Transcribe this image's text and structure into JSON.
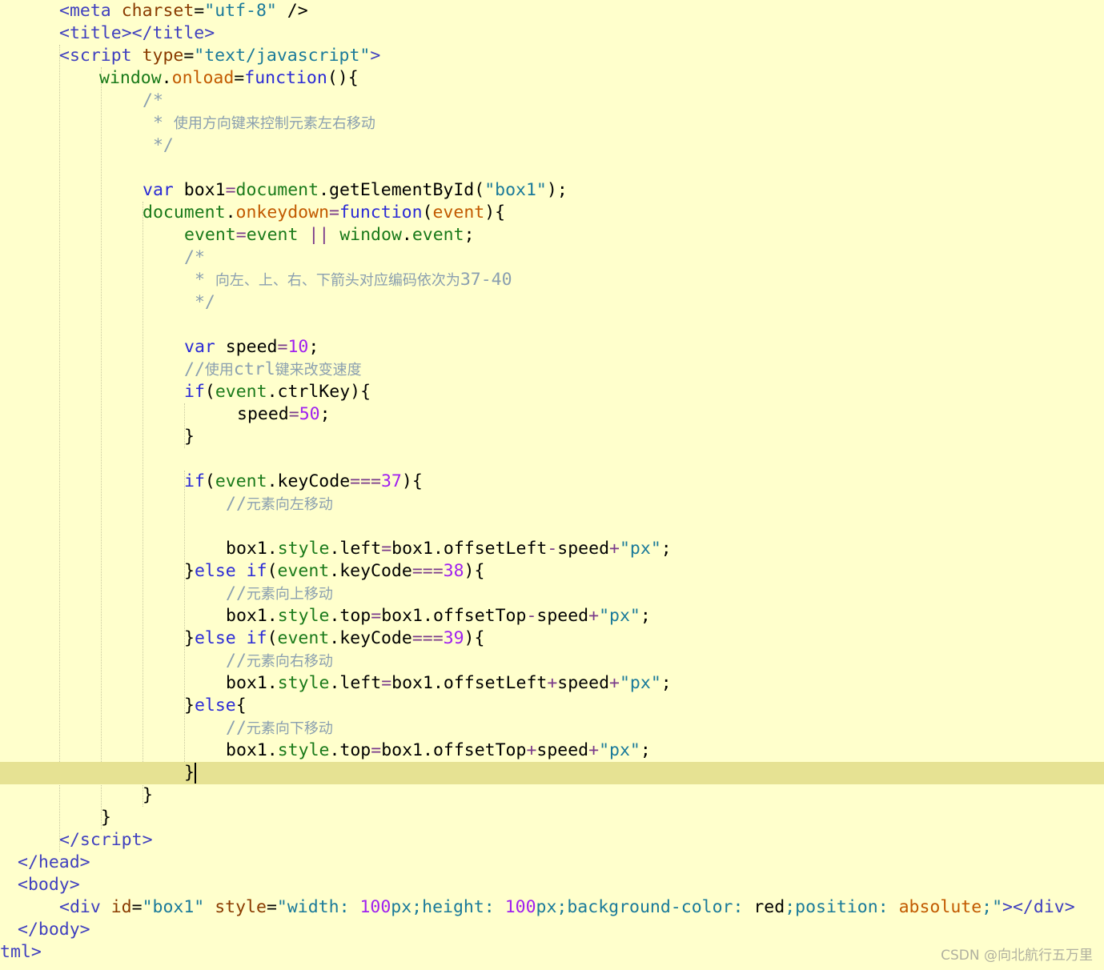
{
  "editor": {
    "lines": [
      {
        "tokens": [
          [
            "tag",
            "<"
          ],
          [
            "tag",
            "meta "
          ],
          [
            "attr",
            "charset"
          ],
          [
            "plain",
            "="
          ],
          [
            "str",
            "\"utf-8\""
          ],
          [
            "plain",
            " />"
          ]
        ]
      },
      {
        "tokens": [
          [
            "tag",
            "<"
          ],
          [
            "tag",
            "title"
          ],
          [
            "tag",
            ">"
          ],
          [
            "tag",
            "</"
          ],
          [
            "tag",
            "title"
          ],
          [
            "tag",
            ">"
          ]
        ]
      },
      {
        "tokens": [
          [
            "tag",
            "<"
          ],
          [
            "tag",
            "script "
          ],
          [
            "attr",
            "type"
          ],
          [
            "plain",
            "="
          ],
          [
            "str",
            "\"text/javascript\""
          ],
          [
            "tag",
            ">"
          ]
        ]
      },
      {
        "tokens": [
          [
            "js",
            "window"
          ],
          [
            "plain",
            "."
          ],
          [
            "prop",
            "onload"
          ],
          [
            "plain",
            "="
          ],
          [
            "kw",
            "function"
          ],
          [
            "plain",
            "(){"
          ]
        ]
      },
      {
        "tokens": [
          [
            "commentmono",
            "/*"
          ]
        ]
      },
      {
        "tokens": [
          [
            "commentmono",
            " * "
          ],
          [
            "comment",
            "使用方向键来控制元素左右移动"
          ]
        ]
      },
      {
        "tokens": [
          [
            "commentmono",
            " */"
          ]
        ]
      },
      {
        "tokens": []
      },
      {
        "tokens": [
          [
            "kw",
            "var "
          ],
          [
            "plain",
            "box1"
          ],
          [
            "op",
            "="
          ],
          [
            "js",
            "document"
          ],
          [
            "plain",
            "."
          ],
          [
            "plain",
            "getElementById"
          ],
          [
            "plain",
            "("
          ],
          [
            "str",
            "\"box1\""
          ],
          [
            "plain",
            ");"
          ]
        ]
      },
      {
        "tokens": [
          [
            "js",
            "document"
          ],
          [
            "plain",
            "."
          ],
          [
            "prop",
            "onkeydown"
          ],
          [
            "op",
            "="
          ],
          [
            "kw",
            "function"
          ],
          [
            "plain",
            "("
          ],
          [
            "prop",
            "event"
          ],
          [
            "plain",
            "){"
          ]
        ]
      },
      {
        "tokens": [
          [
            "js",
            "event"
          ],
          [
            "op",
            "="
          ],
          [
            "js",
            "event"
          ],
          [
            "plain",
            " "
          ],
          [
            "op",
            "||"
          ],
          [
            "plain",
            " "
          ],
          [
            "js",
            "window"
          ],
          [
            "plain",
            "."
          ],
          [
            "js",
            "event"
          ],
          [
            "plain",
            ";"
          ]
        ]
      },
      {
        "tokens": [
          [
            "commentmono",
            "/*"
          ]
        ]
      },
      {
        "tokens": [
          [
            "commentmono",
            " * "
          ],
          [
            "comment",
            "向左、上、右、下箭头对应编码依次为"
          ],
          [
            "commentmono",
            "37-40"
          ]
        ]
      },
      {
        "tokens": [
          [
            "commentmono",
            " */"
          ]
        ]
      },
      {
        "tokens": []
      },
      {
        "tokens": [
          [
            "kw",
            "var "
          ],
          [
            "plain",
            "speed"
          ],
          [
            "op",
            "="
          ],
          [
            "num",
            "10"
          ],
          [
            "plain",
            ";"
          ]
        ]
      },
      {
        "tokens": [
          [
            "commentmono",
            "//"
          ],
          [
            "comment",
            "使用"
          ],
          [
            "commentmono",
            "ctrl"
          ],
          [
            "comment",
            "键来改变速度"
          ]
        ]
      },
      {
        "tokens": [
          [
            "kw",
            "if"
          ],
          [
            "plain",
            "("
          ],
          [
            "js",
            "event"
          ],
          [
            "plain",
            "."
          ],
          [
            "plain",
            "ctrlKey"
          ],
          [
            "plain",
            "){"
          ]
        ]
      },
      {
        "tokens": [
          [
            "plain",
            "speed"
          ],
          [
            "op",
            "="
          ],
          [
            "num",
            "50"
          ],
          [
            "plain",
            ";"
          ]
        ]
      },
      {
        "tokens": [
          [
            "plain",
            "}"
          ]
        ]
      },
      {
        "tokens": []
      },
      {
        "tokens": [
          [
            "kw",
            "if"
          ],
          [
            "plain",
            "("
          ],
          [
            "js",
            "event"
          ],
          [
            "plain",
            "."
          ],
          [
            "plain",
            "keyCode"
          ],
          [
            "op",
            "==="
          ],
          [
            "num",
            "37"
          ],
          [
            "plain",
            "){"
          ]
        ]
      },
      {
        "tokens": [
          [
            "commentmono",
            "//"
          ],
          [
            "comment",
            "元素向左移动"
          ]
        ]
      },
      {
        "tokens": []
      },
      {
        "tokens": [
          [
            "plain",
            "box1"
          ],
          [
            "plain",
            "."
          ],
          [
            "js",
            "style"
          ],
          [
            "plain",
            "."
          ],
          [
            "plain",
            "left"
          ],
          [
            "op",
            "="
          ],
          [
            "plain",
            "box1"
          ],
          [
            "plain",
            "."
          ],
          [
            "plain",
            "offsetLeft"
          ],
          [
            "op",
            "-"
          ],
          [
            "plain",
            "speed"
          ],
          [
            "op",
            "+"
          ],
          [
            "str",
            "\"px\""
          ],
          [
            "plain",
            ";"
          ]
        ]
      },
      {
        "tokens": [
          [
            "plain",
            "}"
          ],
          [
            "kw",
            "else if"
          ],
          [
            "plain",
            "("
          ],
          [
            "js",
            "event"
          ],
          [
            "plain",
            "."
          ],
          [
            "plain",
            "keyCode"
          ],
          [
            "op",
            "==="
          ],
          [
            "num",
            "38"
          ],
          [
            "plain",
            "){"
          ]
        ]
      },
      {
        "tokens": [
          [
            "commentmono",
            "//"
          ],
          [
            "comment",
            "元素向上移动"
          ]
        ]
      },
      {
        "tokens": [
          [
            "plain",
            "box1"
          ],
          [
            "plain",
            "."
          ],
          [
            "js",
            "style"
          ],
          [
            "plain",
            "."
          ],
          [
            "plain",
            "top"
          ],
          [
            "op",
            "="
          ],
          [
            "plain",
            "box1"
          ],
          [
            "plain",
            "."
          ],
          [
            "plain",
            "offsetTop"
          ],
          [
            "op",
            "-"
          ],
          [
            "plain",
            "speed"
          ],
          [
            "op",
            "+"
          ],
          [
            "str",
            "\"px\""
          ],
          [
            "plain",
            ";"
          ]
        ]
      },
      {
        "tokens": [
          [
            "plain",
            "}"
          ],
          [
            "kw",
            "else if"
          ],
          [
            "plain",
            "("
          ],
          [
            "js",
            "event"
          ],
          [
            "plain",
            "."
          ],
          [
            "plain",
            "keyCode"
          ],
          [
            "op",
            "==="
          ],
          [
            "num",
            "39"
          ],
          [
            "plain",
            "){"
          ]
        ]
      },
      {
        "tokens": [
          [
            "commentmono",
            "//"
          ],
          [
            "comment",
            "元素向右移动"
          ]
        ]
      },
      {
        "tokens": [
          [
            "plain",
            "box1"
          ],
          [
            "plain",
            "."
          ],
          [
            "js",
            "style"
          ],
          [
            "plain",
            "."
          ],
          [
            "plain",
            "left"
          ],
          [
            "op",
            "="
          ],
          [
            "plain",
            "box1"
          ],
          [
            "plain",
            "."
          ],
          [
            "plain",
            "offsetLeft"
          ],
          [
            "op",
            "+"
          ],
          [
            "plain",
            "speed"
          ],
          [
            "op",
            "+"
          ],
          [
            "str",
            "\"px\""
          ],
          [
            "plain",
            ";"
          ]
        ]
      },
      {
        "tokens": [
          [
            "plain",
            "}"
          ],
          [
            "kw",
            "else"
          ],
          [
            "plain",
            "{"
          ]
        ]
      },
      {
        "tokens": [
          [
            "commentmono",
            "//"
          ],
          [
            "comment",
            "元素向下移动"
          ]
        ]
      },
      {
        "tokens": [
          [
            "plain",
            "box1"
          ],
          [
            "plain",
            "."
          ],
          [
            "js",
            "style"
          ],
          [
            "plain",
            "."
          ],
          [
            "plain",
            "top"
          ],
          [
            "op",
            "="
          ],
          [
            "plain",
            "box1"
          ],
          [
            "plain",
            "."
          ],
          [
            "plain",
            "offsetTop"
          ],
          [
            "op",
            "+"
          ],
          [
            "plain",
            "speed"
          ],
          [
            "op",
            "+"
          ],
          [
            "str",
            "\"px\""
          ],
          [
            "plain",
            ";"
          ]
        ]
      },
      {
        "tokens": [
          [
            "plain",
            "}"
          ]
        ]
      },
      {
        "tokens": [
          [
            "plain",
            "}"
          ]
        ]
      },
      {
        "tokens": [
          [
            "plain",
            "}"
          ]
        ]
      },
      {
        "tokens": [
          [
            "tag",
            "</"
          ],
          [
            "tag",
            "script"
          ],
          [
            "tag",
            ">"
          ]
        ]
      },
      {
        "tokens": [
          [
            "tag",
            "</"
          ],
          [
            "tag",
            "head"
          ],
          [
            "tag",
            ">"
          ]
        ]
      },
      {
        "tokens": [
          [
            "tag",
            "<"
          ],
          [
            "tag",
            "body"
          ],
          [
            "tag",
            ">"
          ]
        ]
      },
      {
        "tokens": [
          [
            "tag",
            "<"
          ],
          [
            "tag",
            "div "
          ],
          [
            "attr",
            "id"
          ],
          [
            "plain",
            "="
          ],
          [
            "str",
            "\"box1\""
          ],
          [
            "plain",
            " "
          ],
          [
            "attr",
            "style"
          ],
          [
            "plain",
            "="
          ],
          [
            "str",
            "\""
          ],
          [
            "str",
            "width: "
          ],
          [
            "num",
            "100"
          ],
          [
            "str",
            "px;height: "
          ],
          [
            "num",
            "100"
          ],
          [
            "str",
            "px;background-color: "
          ],
          [
            "plain",
            "red"
          ],
          [
            "str",
            ";position: "
          ],
          [
            "prop",
            "absolute"
          ],
          [
            "str",
            ";\""
          ],
          [
            "tag",
            "></"
          ],
          [
            "tag",
            "div"
          ],
          [
            "tag",
            ">"
          ]
        ]
      },
      {
        "tokens": [
          [
            "tag",
            "</"
          ],
          [
            "tag",
            "body"
          ],
          [
            "tag",
            ">"
          ]
        ]
      },
      {
        "tokens": [
          [
            "tag",
            "tml"
          ],
          [
            "tag",
            ">"
          ]
        ]
      }
    ]
  },
  "watermark": "CSDN @向北航行五万里"
}
